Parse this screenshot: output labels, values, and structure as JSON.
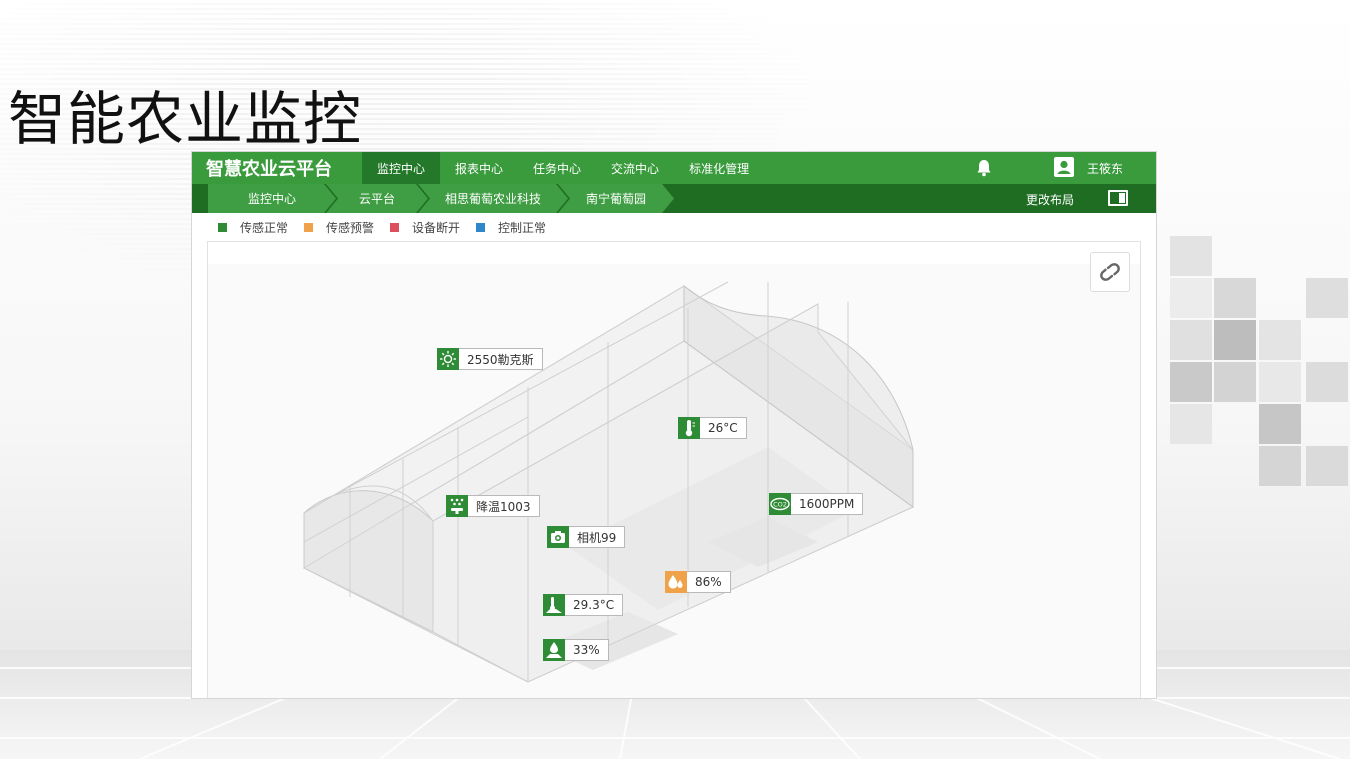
{
  "slide": {
    "title": "智能农业监控"
  },
  "header": {
    "brand": "智慧农业云平台",
    "nav": [
      {
        "label": "监控中心",
        "active": true
      },
      {
        "label": "报表中心",
        "active": false
      },
      {
        "label": "任务中心",
        "active": false
      },
      {
        "label": "交流中心",
        "active": false
      },
      {
        "label": "标准化管理",
        "active": false
      }
    ],
    "user": "王筱东"
  },
  "breadcrumb": {
    "items": [
      "监控中心",
      "云平台",
      "相思葡萄农业科技",
      "南宁葡萄园"
    ],
    "layout_button": "更改布局"
  },
  "legend": [
    {
      "label": "传感正常",
      "color": "#2e8b36"
    },
    {
      "label": "传感预警",
      "color": "#f0a24a"
    },
    {
      "label": "设备断开",
      "color": "#dd4f5c"
    },
    {
      "label": "控制正常",
      "color": "#2d87c9"
    }
  ],
  "sensors": [
    {
      "icon": "sun-icon",
      "value": "2550勒克斯",
      "status": "normal"
    },
    {
      "icon": "thermometer-icon",
      "value": "26°C",
      "status": "normal"
    },
    {
      "icon": "sprinkler-icon",
      "value": "降温1003",
      "status": "normal"
    },
    {
      "icon": "co2-icon",
      "value": "1600PPM",
      "status": "normal"
    },
    {
      "icon": "camera-icon",
      "value": "相机99",
      "status": "normal"
    },
    {
      "icon": "humidity-icon",
      "value": "86%",
      "status": "warning"
    },
    {
      "icon": "soil-temperature-icon",
      "value": "29.3°C",
      "status": "normal"
    },
    {
      "icon": "soil-moisture-icon",
      "value": "33%",
      "status": "normal"
    }
  ],
  "colors": {
    "brand_green": "#3a9b3d",
    "dark_green": "#1f6d23",
    "warning": "#f0a24a"
  }
}
